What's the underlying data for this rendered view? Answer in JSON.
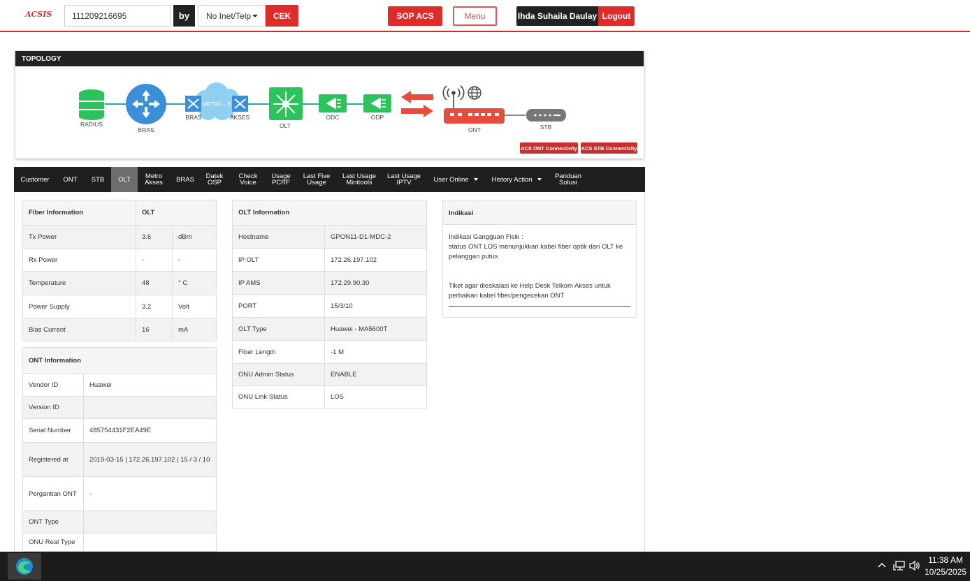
{
  "header": {
    "logo": "ACSIS",
    "search_value": "111209216695",
    "by_label": "by",
    "search_by_selected": "No Inet/Telp",
    "cek_label": "CEK",
    "sop_label": "SOP ACS",
    "menu_label": "Menu",
    "user_name": "Ihda Suhaila Daulay",
    "logout_label": "Logout"
  },
  "topology": {
    "title": "TOPOLOGY",
    "nodes": {
      "radius": "RADIUS",
      "bras": "BRAS",
      "bras2": "BRAS",
      "metro": "METRO - E",
      "akses": "AKSES",
      "olt": "OLT",
      "odc": "ODC",
      "odp": "ODP",
      "ont": "ONT",
      "stb": "STB"
    },
    "acs_ont_label": "ACS ONT Connectivity",
    "acs_stb_label": "ACS STB Connectivity",
    "colors": {
      "accent": "#e02b2b",
      "blue": "#3a8fd8",
      "green": "#2dc25d",
      "line": "#2aa8a0"
    }
  },
  "tabs": [
    {
      "label": "Customer"
    },
    {
      "label": "ONT"
    },
    {
      "label": "STB"
    },
    {
      "label": "OLT"
    },
    {
      "label1": "Metro",
      "label2": "Akses"
    },
    {
      "label": "BRAS"
    },
    {
      "label1": "Datek",
      "label2": "OSP"
    },
    {
      "label1": "Check",
      "label2": "Voice"
    },
    {
      "label1": "Usage",
      "label2": "PCRF"
    },
    {
      "label1": "Last Five",
      "label2": "Usage"
    },
    {
      "label1": "Last Usage",
      "label2": "Minitools"
    },
    {
      "label1": "Last Usage",
      "label2": "IPTV"
    },
    {
      "label": "User Online"
    },
    {
      "label": "History Action"
    },
    {
      "label1": "Panduan",
      "label2": "Solusi"
    }
  ],
  "fiber": {
    "header_left": "Fiber Information",
    "header_right": "OLT",
    "rows": [
      {
        "label": "Tx Power",
        "value": "3.6",
        "unit": "dBm"
      },
      {
        "label": "Rx Power",
        "value": "-",
        "unit": "-"
      },
      {
        "label": "Temperature",
        "value": "48",
        "unit": "° C"
      },
      {
        "label": "Power Supply",
        "value": "3.2",
        "unit": "Volt"
      },
      {
        "label": "Bias Current",
        "value": "16",
        "unit": "mA"
      }
    ]
  },
  "ont": {
    "header": "ONT Information",
    "rows": [
      {
        "label": "Vendor ID",
        "value": "Huawei"
      },
      {
        "label": "Version ID",
        "value": ""
      },
      {
        "label": "Serial Number",
        "value": "485754431F2EA49E"
      },
      {
        "label": "Registered at",
        "value": "2019-03-15 | 172.26.197.102 | 15 / 3 / 10"
      },
      {
        "label": "Pergantian ONT",
        "value": "-"
      },
      {
        "label": "ONT Type",
        "value": ""
      },
      {
        "label": "ONU Real Type",
        "value": ""
      }
    ]
  },
  "olt": {
    "header": "OLT Information",
    "rows": [
      {
        "label": "Hostname",
        "value": "GPON11-D1-MDC-2"
      },
      {
        "label": "IP OLT",
        "value": "172.26.197.102"
      },
      {
        "label": "IP AMS",
        "value": "172.29.90.30"
      },
      {
        "label": "PORT",
        "value": "15/3/10"
      },
      {
        "label": "OLT Type",
        "value": "Huawei - MA5600T"
      },
      {
        "label": "Fiber Length",
        "value": "-1 M"
      },
      {
        "label": "ONU Admin Status",
        "value": "ENABLE"
      },
      {
        "label": "ONU Link Status",
        "value": "LOS"
      }
    ]
  },
  "indikasi": {
    "header": "Indikasi",
    "line1": "Indikasi Gangguan Fisik :",
    "line2": "status ONT LOS menunjukkan kabel fiber optik dari OLT ke pelanggan putus",
    "line3": "Tiket agar dieskalasi ke Help Desk Telkom Akses untuk perbaikan kabel fiber/pengecekan ONT"
  },
  "taskbar": {
    "time": "11:38 AM",
    "date": "10/25/2025",
    "icons": [
      "edge-icon",
      "chevron-up-icon",
      "network-icon",
      "volume-icon"
    ]
  }
}
